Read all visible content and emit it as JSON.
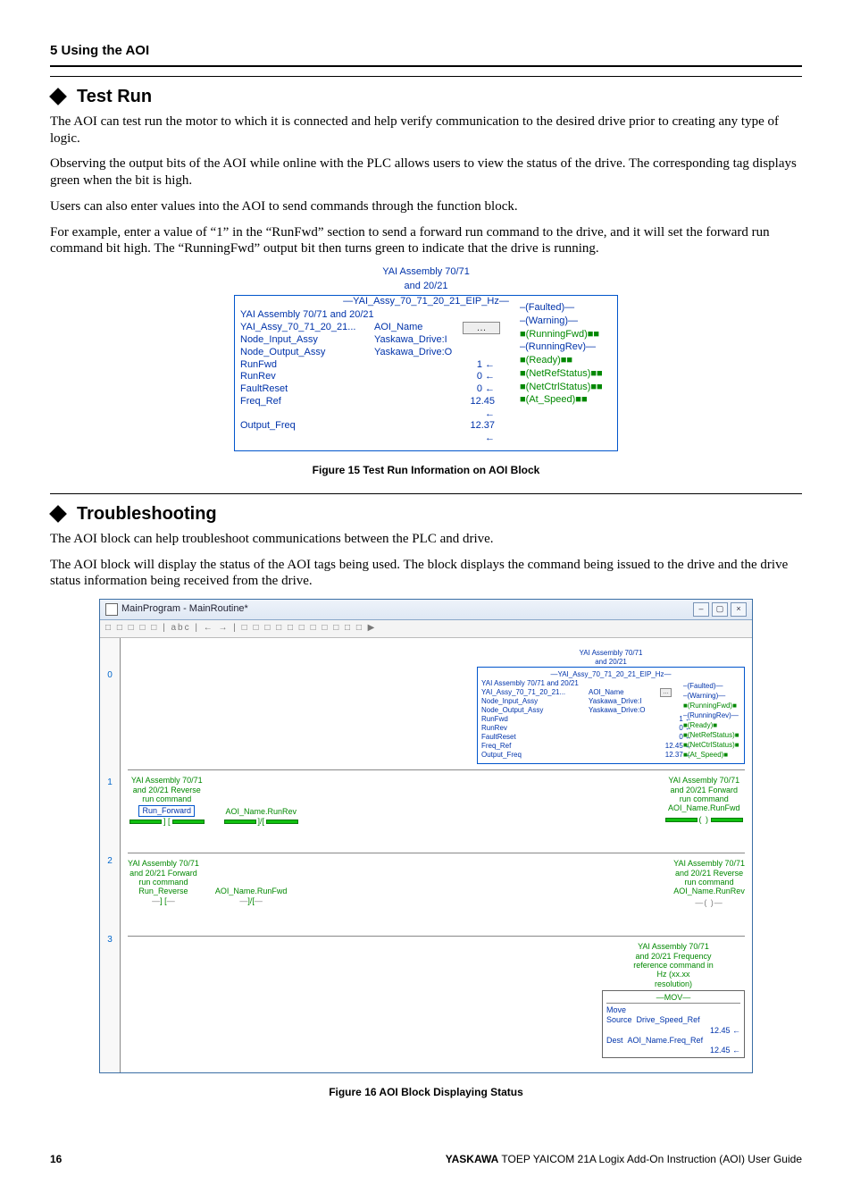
{
  "section": "5 Using the AOI",
  "h_testrun": "Test Run",
  "p1": "The AOI can test run the motor to which it is connected and help verify communication to the desired drive prior to creating any type of logic.",
  "p2": "Observing the output bits of the AOI while online with the PLC allows users to view the status of the drive. The corresponding tag displays green when the bit is high.",
  "p3": "Users can also enter values into the AOI to send commands through the function block.",
  "p4": "For example, enter a value of “1” in the “RunFwd” section to send a forward run command to the drive, and it will set the forward run command bit high. The “RunningFwd” output bit then turns green to indicate that the drive is running.",
  "fig15": {
    "title1": "YAI Assembly 70/71",
    "title2": "and 20/21",
    "inst": "YAI_Assy_70_71_20_21_EIP_Hz",
    "desc": "YAI Assembly 70/71 and 20/21",
    "rows": [
      {
        "l": "YAI_Assy_70_71_20_21...",
        "m": "AOI_Name",
        "r": "",
        "btn": true
      },
      {
        "l": "Node_Input_Assy",
        "m": "Yaskawa_Drive:I",
        "r": ""
      },
      {
        "l": "Node_Output_Assy",
        "m": "Yaskawa_Drive:O",
        "r": ""
      },
      {
        "l": "RunFwd",
        "m": "",
        "r": "1 ←"
      },
      {
        "l": "RunRev",
        "m": "",
        "r": "0 ←"
      },
      {
        "l": "FaultReset",
        "m": "",
        "r": "0 ←"
      },
      {
        "l": "Freq_Ref",
        "m": "",
        "r": "12.45 ←"
      },
      {
        "l": "Output_Freq",
        "m": "",
        "r": "12.37 ←"
      }
    ],
    "tags": [
      {
        "name": "Faulted",
        "on": false
      },
      {
        "name": "Warning",
        "on": false
      },
      {
        "name": "RunningFwd",
        "on": true
      },
      {
        "name": "RunningRev",
        "on": false
      },
      {
        "name": "Ready",
        "on": true
      },
      {
        "name": "NetRefStatus",
        "on": true
      },
      {
        "name": "NetCtrlStatus",
        "on": true
      },
      {
        "name": "At_Speed",
        "on": true
      }
    ]
  },
  "fig15cap": "Figure 15  Test Run Information on AOI Block",
  "h_trouble": "Troubleshooting",
  "p5": "The AOI block can help troubleshoot communications between the PLC and drive.",
  "p6": "The AOI block will display the status of the AOI tags being used. The block displays the command being issued to the drive and the drive status information being received from the drive.",
  "fig16": {
    "win_title": "MainProgram - MainRoutine*",
    "toolbar_glyphs": "□ □ □ □ □   | abc |   ← →   |   □ □ □   □ □   □ □   □ □   □ □      ▶",
    "rungs": [
      "0",
      "1",
      "2",
      "3"
    ],
    "runfwd_desc": [
      "YAI Assembly 70/71",
      "and 20/21 Reverse",
      "run command"
    ],
    "runfwd_tag_left": "Run_Forward",
    "runfwd_tag_right": "AOI_Name.RunRev",
    "coil_fwd_desc": [
      "YAI Assembly 70/71",
      "and 20/21 Forward",
      "run command"
    ],
    "coil_fwd_tag": "AOI_Name.RunFwd",
    "runrev_desc": [
      "YAI Assembly 70/71",
      "and 20/21 Forward",
      "run command"
    ],
    "runrev_tag_left": "Run_Reverse",
    "runrev_tag_right": "AOI_Name.RunFwd",
    "coil_rev_desc": [
      "YAI Assembly 70/71",
      "and 20/21 Reverse",
      "run command"
    ],
    "coil_rev_tag": "AOI_Name.RunRev",
    "mov_desc": [
      "YAI Assembly 70/71",
      "and 20/21 Frequency",
      "reference command in",
      "Hz (xx.xx",
      "resolution)"
    ],
    "mov_title": "MOV",
    "mov_move": "Move",
    "mov_src_l": "Source",
    "mov_src_v": "Drive_Speed_Ref",
    "mov_src_n": "12.45 ←",
    "mov_dst_l": "Dest",
    "mov_dst_v": "AOI_Name.Freq_Ref",
    "mov_dst_n": "12.45 ←"
  },
  "fig16cap": "Figure 16  AOI Block Displaying Status",
  "footer": {
    "page": "16",
    "brand": "YASKAWA",
    "doc": " TOEP YAICOM 21A Logix Add-On Instruction (AOI) User Guide"
  }
}
